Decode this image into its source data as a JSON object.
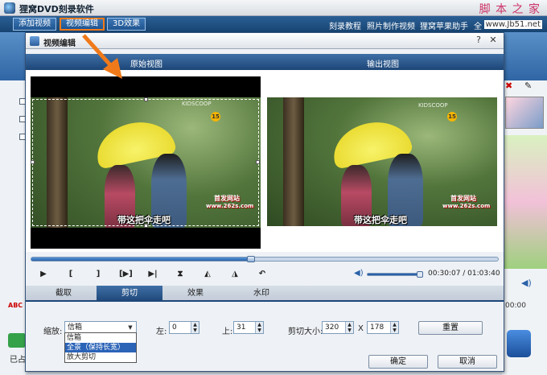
{
  "app": {
    "title": "狸窝DVD刻录软件",
    "watermark": "脚 本 之 家",
    "watermark_url": "www.Jb51.net"
  },
  "toolbar": {
    "tabs": [
      {
        "label": "添加视频",
        "active": false
      },
      {
        "label": "视频编辑",
        "active": true
      },
      {
        "label": "3D效果",
        "active": false
      }
    ],
    "links": [
      "刻录教程",
      "照片制作视频",
      "狸窝苹果助手",
      "全"
    ]
  },
  "background": {
    "status_text": "已占",
    "time_text": "00:00",
    "abc_label": "ABC"
  },
  "dialog": {
    "title": "视频编辑",
    "original_view_label": "原始视图",
    "output_view_label": "输出视图",
    "video": {
      "subtitle": "带这把伞走吧",
      "channel_badge": "15",
      "top_watermark": "KIDSCOOP",
      "site_watermark_1": "首发网站",
      "site_watermark_2": "www.262s.com"
    },
    "playback": {
      "seek_progress": 0.47,
      "volume_level": 0.95,
      "time_readout": "00:30:07 / 01:03:40",
      "buttons": [
        "play",
        "mark-in",
        "mark-out",
        "play-selection",
        "next-frame",
        "split",
        "rotate-left",
        "rotate-right",
        "undo"
      ],
      "button_glyphs": [
        "▶",
        "[",
        "]",
        "[▶]",
        "▶|",
        "⧗",
        "◭",
        "◮",
        "↶"
      ]
    },
    "tabs": [
      {
        "label": "截取",
        "active": false
      },
      {
        "label": "剪切",
        "active": true
      },
      {
        "label": "效果",
        "active": false
      },
      {
        "label": "水印",
        "active": false
      }
    ],
    "crop": {
      "zoom_label": "缩放:",
      "zoom_value": "信箱",
      "zoom_options": [
        "信箱",
        "全景（保持长宽）",
        "放大剪切"
      ],
      "zoom_highlighted": "全景（保持长宽）",
      "left_label": "左:",
      "left_value": "0",
      "top_label": "上:",
      "top_value": "31",
      "size_label": "剪切大小:",
      "width_value": "320",
      "size_sep": "X",
      "height_value": "178",
      "reset_label": "重置"
    },
    "ok_label": "确定",
    "cancel_label": "取消"
  },
  "colors": {
    "accent_orange": "#f07a1a",
    "header_blue": "#1d4677",
    "highlight_blue": "#2b63b7"
  }
}
